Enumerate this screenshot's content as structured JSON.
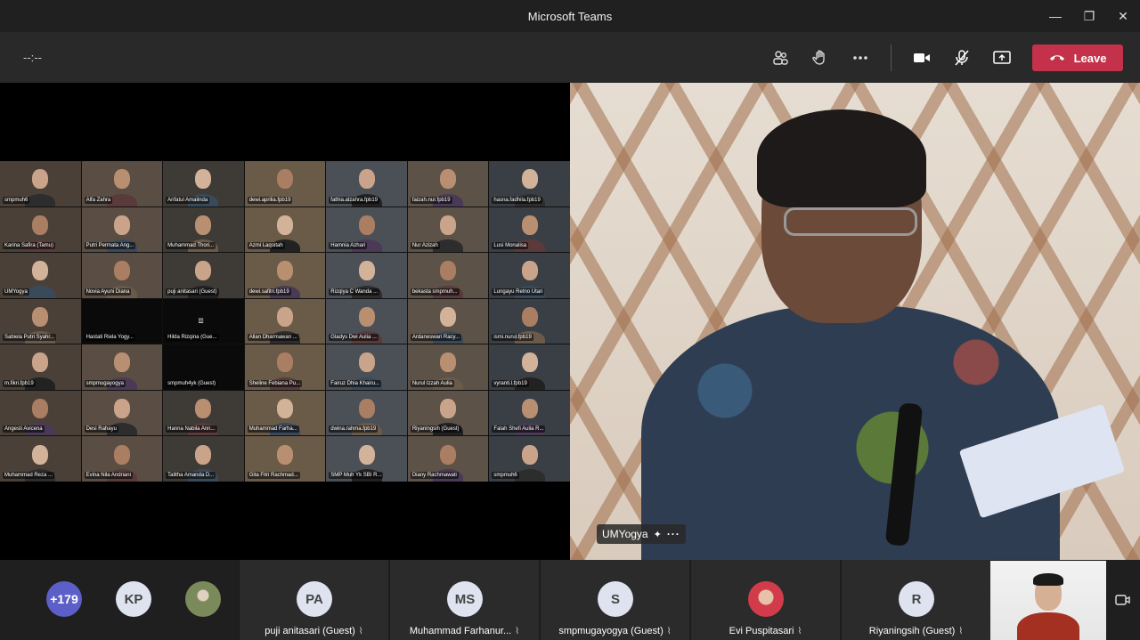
{
  "window": {
    "title": "Microsoft Teams"
  },
  "toolbar": {
    "timer": "--:--",
    "leave_label": "Leave"
  },
  "speaker": {
    "name": "UMYogya"
  },
  "grid": [
    {
      "name": "smpmuh6",
      "cam": true
    },
    {
      "name": "Alfa Zahra",
      "cam": true
    },
    {
      "name": "Arifatul Amalinda",
      "cam": true
    },
    {
      "name": "dewi.aprilia.fpb19",
      "cam": true
    },
    {
      "name": "fathia.alzahra.fpb19",
      "cam": true
    },
    {
      "name": "faizah.nur.fpb19",
      "cam": true
    },
    {
      "name": "hasna.fadhila.fpb19",
      "cam": true
    },
    {
      "name": "Karina Safira (Tamu)",
      "cam": true
    },
    {
      "name": "Putri Permata Ang...",
      "cam": true
    },
    {
      "name": "Muhammad Thori...",
      "cam": true
    },
    {
      "name": "Azmi Laqoitah",
      "cam": true
    },
    {
      "name": "Hamnia Azhari",
      "cam": true
    },
    {
      "name": "Nur Azizah",
      "cam": true
    },
    {
      "name": "Lusi Monalisa",
      "cam": true
    },
    {
      "name": "UMYogya",
      "cam": true
    },
    {
      "name": "Novia Ayuni Diana",
      "cam": true
    },
    {
      "name": "puji anitasari (Guest)",
      "cam": true
    },
    {
      "name": "dewi.safitri.fpb19",
      "cam": true
    },
    {
      "name": "Rizqiya C Wanda ...",
      "cam": true
    },
    {
      "name": "bekasta smpmuh...",
      "cam": true
    },
    {
      "name": "Lungayu Retno Utari",
      "cam": true
    },
    {
      "name": "Sabiela Putri Syahr...",
      "cam": true
    },
    {
      "name": "Hastati Riela Yogy...",
      "cam": false
    },
    {
      "name": "Hilda Rizqina (Gue...",
      "cam": false
    },
    {
      "name": "Allan Dharmawan ...",
      "cam": true
    },
    {
      "name": "Gladys Dwi Aulia ...",
      "cam": true
    },
    {
      "name": "Ardaneswari Racy...",
      "cam": true
    },
    {
      "name": "ismi.nurul.fpb19",
      "cam": true
    },
    {
      "name": "m.fikri.fpb19",
      "cam": true
    },
    {
      "name": "smpmugayogya",
      "cam": true
    },
    {
      "name": "smpmuh4yk (Guest)",
      "cam": false
    },
    {
      "name": "Sheline Febiana Pu...",
      "cam": true
    },
    {
      "name": "Fairuz Dhia Khairu...",
      "cam": true
    },
    {
      "name": "Nurul Izzah Aulia",
      "cam": true
    },
    {
      "name": "vyranti.l.fpb19",
      "cam": true
    },
    {
      "name": "Angesti Avicena",
      "cam": true
    },
    {
      "name": "Desi Rahayu",
      "cam": true
    },
    {
      "name": "Hanna Nabila Ann...",
      "cam": true
    },
    {
      "name": "Muhammad Farha...",
      "cam": true
    },
    {
      "name": "dwina.rahma.fpb19",
      "cam": true
    },
    {
      "name": "Riyaningsih (Guest)",
      "cam": true
    },
    {
      "name": "Falah Shefi Aulia R...",
      "cam": true
    },
    {
      "name": "Muhammad Reza ...",
      "cam": true
    },
    {
      "name": "Evina Nila Andriani",
      "cam": true
    },
    {
      "name": "Talitha Amanda D...",
      "cam": true
    },
    {
      "name": "Gita Fitri Rachmad...",
      "cam": true
    },
    {
      "name": "SMP Muh Yk SBI R...",
      "cam": true
    },
    {
      "name": "Diany Rachmawati",
      "cam": true
    },
    {
      "name": "smpmuh6",
      "cam": true
    }
  ],
  "roster": {
    "more_count": "+179",
    "kp_initials": "KP",
    "tiles": [
      {
        "initials": "PA",
        "name": "puji anitasari (Guest)"
      },
      {
        "initials": "MS",
        "name": "Muhammad Farhanur..."
      },
      {
        "initials": "S",
        "name": "smpmugayogya (Guest)"
      },
      {
        "initials": "",
        "name": "Evi Puspitasari"
      },
      {
        "initials": "R",
        "name": "Riyaningsih (Guest)"
      }
    ]
  }
}
